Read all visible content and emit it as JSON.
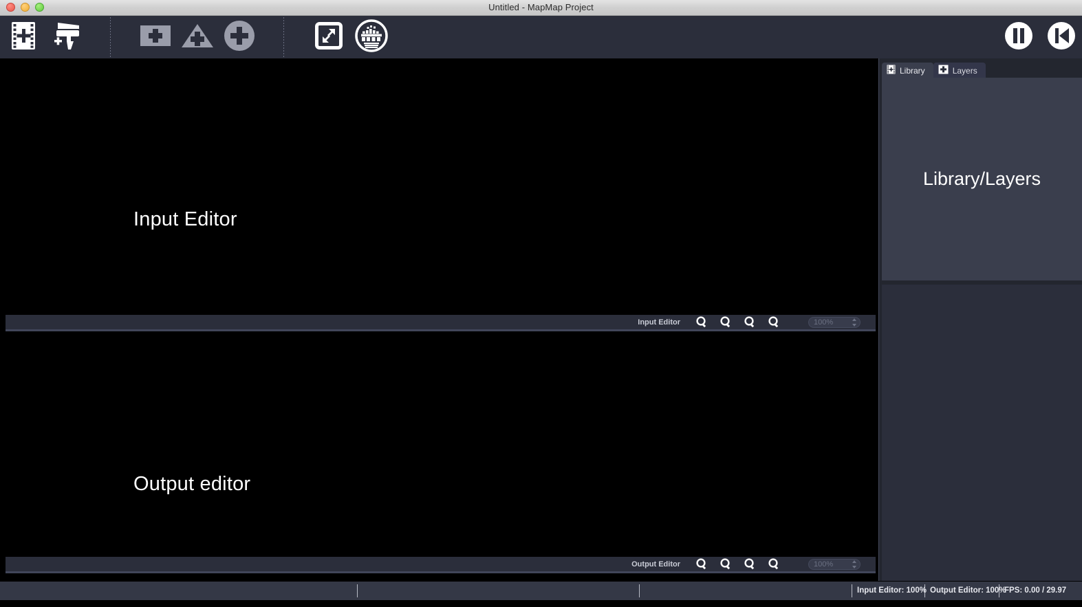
{
  "window": {
    "title": "Untitled - MapMap Project",
    "controls": [
      "close",
      "minimize",
      "maximize"
    ]
  },
  "toolbar": {
    "groups": [
      {
        "name": "media",
        "buttons": [
          {
            "icon": "add-media-film-icon",
            "label": "Add Media File"
          },
          {
            "icon": "add-color-paint-icon",
            "label": "Add Color Paint"
          }
        ]
      },
      {
        "name": "shapes",
        "buttons": [
          {
            "icon": "add-quad-mesh-icon",
            "label": "Add Quad/Mesh"
          },
          {
            "icon": "add-triangle-icon",
            "label": "Add Triangle"
          },
          {
            "icon": "add-ellipse-icon",
            "label": "Add Ellipse"
          }
        ]
      },
      {
        "name": "view",
        "buttons": [
          {
            "icon": "fullscreen-icon",
            "label": "Toggle Fullscreen"
          },
          {
            "icon": "test-signal-icon",
            "label": "Display Test Signal"
          }
        ]
      },
      {
        "name": "transport",
        "buttons": [
          {
            "icon": "pause-icon",
            "label": "Pause"
          },
          {
            "icon": "rewind-icon",
            "label": "Rewind"
          }
        ]
      }
    ]
  },
  "editors": {
    "input": {
      "canvas_label": "Input Editor",
      "zoombar": {
        "title": "Input Editor",
        "buttons": [
          {
            "icon": "zoom-in-icon",
            "label": "Zoom In"
          },
          {
            "icon": "zoom-out-icon",
            "label": "Zoom Out"
          },
          {
            "icon": "zoom-reset-icon",
            "label": "Reset Zoom"
          },
          {
            "icon": "zoom-fit-icon",
            "label": "Fit To View"
          }
        ],
        "zoom_value": "100%"
      }
    },
    "output": {
      "canvas_label": "Output editor",
      "zoombar": {
        "title": "Output Editor",
        "buttons": [
          {
            "icon": "zoom-in-icon",
            "label": "Zoom In"
          },
          {
            "icon": "zoom-out-icon",
            "label": "Zoom Out"
          },
          {
            "icon": "zoom-reset-icon",
            "label": "Reset Zoom"
          },
          {
            "icon": "zoom-fit-icon",
            "label": "Fit To View"
          }
        ],
        "zoom_value": "100%"
      }
    }
  },
  "right_dock": {
    "tabs": [
      {
        "label": "Library",
        "icon": "film-strip-icon",
        "active": true
      },
      {
        "label": "Layers",
        "icon": "plus-square-icon",
        "active": false
      }
    ],
    "library_pane_text": "Library/Layers"
  },
  "statusbar": {
    "items": [
      {
        "name": "input-editor-zoom",
        "text": "Input Editor: 100%"
      },
      {
        "name": "output-editor-zoom",
        "text": "Output Editor: 100%"
      },
      {
        "name": "fps",
        "text": "FPS: 0.00 / 29.97"
      }
    ]
  },
  "colors": {
    "toolbar_bg": "#2b2e3b",
    "canvas_bg": "#000000",
    "dock_bg": "#23262f",
    "pane_bg": "#3a3e4d",
    "statusbar_bg": "#343846",
    "titlebar_bg": "#d0d0d0",
    "icon_white": "#ffffff",
    "icon_gray": "#9a9daa"
  }
}
